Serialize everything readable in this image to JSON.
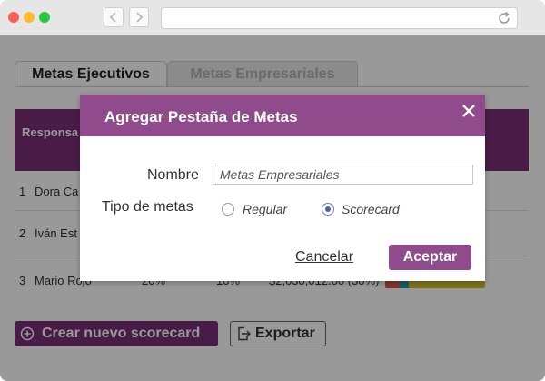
{
  "tabs": [
    {
      "label": "Metas Ejecutivos",
      "active": true
    },
    {
      "label": "Metas Empresariales",
      "active": false
    }
  ],
  "table": {
    "header_first_col": "Responsa",
    "rows": [
      {
        "num": "1",
        "name": "Dora Ca",
        "p1": "",
        "p2": "",
        "amount": ""
      },
      {
        "num": "2",
        "name": "Iván Est",
        "p1": "",
        "p2": "",
        "amount": ""
      },
      {
        "num": "3",
        "name": "Mario Rojo",
        "p1": "20%",
        "p2": "10%",
        "amount": "$2,030,012.00 (30%)"
      }
    ],
    "bar_colors": [
      "#d9584a",
      "#2a9aa3",
      "#d8c22a"
    ]
  },
  "actions": {
    "create_label": "Crear nuevo scorecard",
    "export_label": "Exportar"
  },
  "modal": {
    "title": "Agregar Pestaña de Metas",
    "name_label": "Nombre",
    "name_value": "Metas Empresariales",
    "type_label": "Tipo de metas",
    "options": [
      {
        "label": "Regular",
        "selected": false
      },
      {
        "label": "Scorecard",
        "selected": true
      }
    ],
    "cancel_label": "Cancelar",
    "accept_label": "Aceptar"
  },
  "colors": {
    "accent": "#7b2f78",
    "modal_header": "#8f4b8c"
  },
  "icons": {
    "back": "chevron-left-icon",
    "forward": "chevron-right-icon",
    "reload": "reload-icon",
    "close": "close-icon",
    "plus": "plus-circle-icon",
    "export": "export-icon"
  }
}
